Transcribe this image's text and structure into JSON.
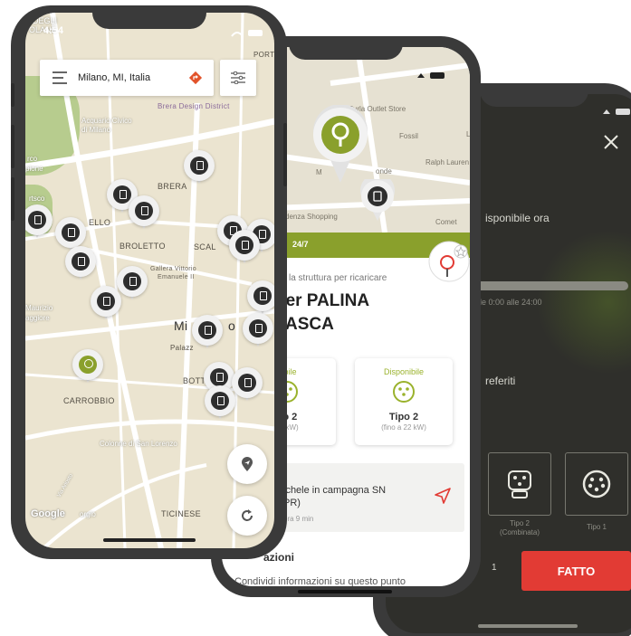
{
  "phone_front": {
    "status_time": "4:54",
    "search": {
      "value": "Milano, MI, Italia"
    },
    "map_labels": {
      "degli": "DEGLI",
      "olane": "OLANE",
      "port": "PORT",
      "brera_design": "Brera Design District",
      "acquario": "Acquario Civico",
      "di_milano": "di Milano",
      "arco": "rco",
      "pione": "pione",
      "brera": "BRERA",
      "rtsco": "rtsco",
      "ello": "ELLO",
      "broletto": "BROLETTO",
      "scal": "SCAL",
      "gallera1": "Gallera Vittorio",
      "gallera2": "Emanuele II",
      "maurizio": "Maurizio",
      "aggiore": "aggiore",
      "milano_m": "Mi",
      "milano_o": "o",
      "palazz": "Palazz",
      "bott": "BOTT",
      "carrobbio": "CARROBBIO",
      "colonne": "Colonne di San Lorenzo",
      "ticinese": "TICINESE",
      "orgio": "orgio",
      "via": "Via Ariosto"
    },
    "google_logo": "Google"
  },
  "phone_middle": {
    "map_labels": {
      "furla": "Furla Outlet Store",
      "fossil": "Fossil",
      "ralph": "Ralph Lauren",
      "m": "M",
      "onde": "onde",
      "denza": "denza Shopping",
      "comet": "Comet",
      "la": "La"
    },
    "hours_badge": "24/7",
    "subtitle": "la struttura per ricaricare",
    "title_line1": "ver PALINA",
    "title_line2": "ASCA",
    "cards": [
      {
        "avail": "nibile",
        "tipo": "po 2",
        "power": "22 kW)"
      },
      {
        "avail": "Disponibile",
        "tipo": "Tipo 2",
        "power": "(fino a 22 kW)"
      }
    ],
    "address_head": "",
    "address_line1": "ichele in campagna SN",
    "address_line2": "PR)",
    "address_time": "ora 9 min",
    "section_title": "azioni",
    "share_text": "Condividi informazioni su questo punto"
  },
  "phone_back": {
    "available_now": "isponibile ora",
    "hours_range": "le 0:00 alle 24:00",
    "favourites": "referiti",
    "connectors": [
      {
        "label": "Tipo 2",
        "sub": "(Combinata)"
      },
      {
        "label": "Tipo 1",
        "sub": ""
      }
    ],
    "left_digit": "1",
    "done_button": "FATTO"
  },
  "colors": {
    "accent_green": "#8aa02c",
    "done_red": "#e23b34",
    "map_bg": "#ebe4d0"
  }
}
